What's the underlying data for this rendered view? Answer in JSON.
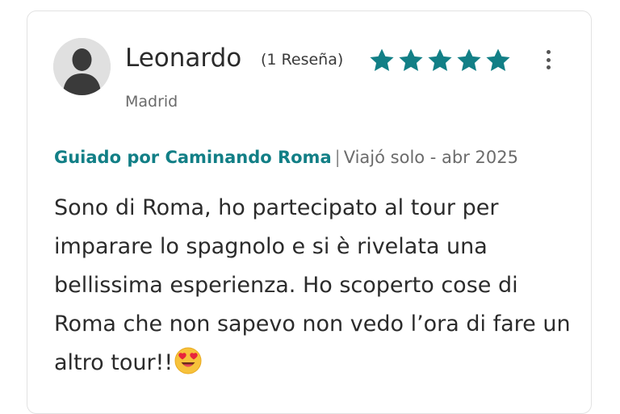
{
  "review": {
    "author": {
      "name": "Leonardo",
      "review_count": "(1 Reseña)",
      "location": "Madrid",
      "avatar_icon": "user-silhouette-icon"
    },
    "rating": {
      "value": 5,
      "max": 5,
      "star_color": "#127f86"
    },
    "more_options_icon": "vertical-ellipsis-icon",
    "guide_link": "Guiado por Caminando Roma",
    "separator": "|",
    "trip_info": "Viajó solo - abr 2025",
    "text": "Sono di Roma, ho partecipato al tour per imparare lo spagnolo e si è rivelata una bellissima esperienza. Ho scoperto cose di Roma che non sapevo non vedo l’ora di fare un altro tour!!",
    "emoji": "smiling-face-with-heart-eyes-icon"
  }
}
